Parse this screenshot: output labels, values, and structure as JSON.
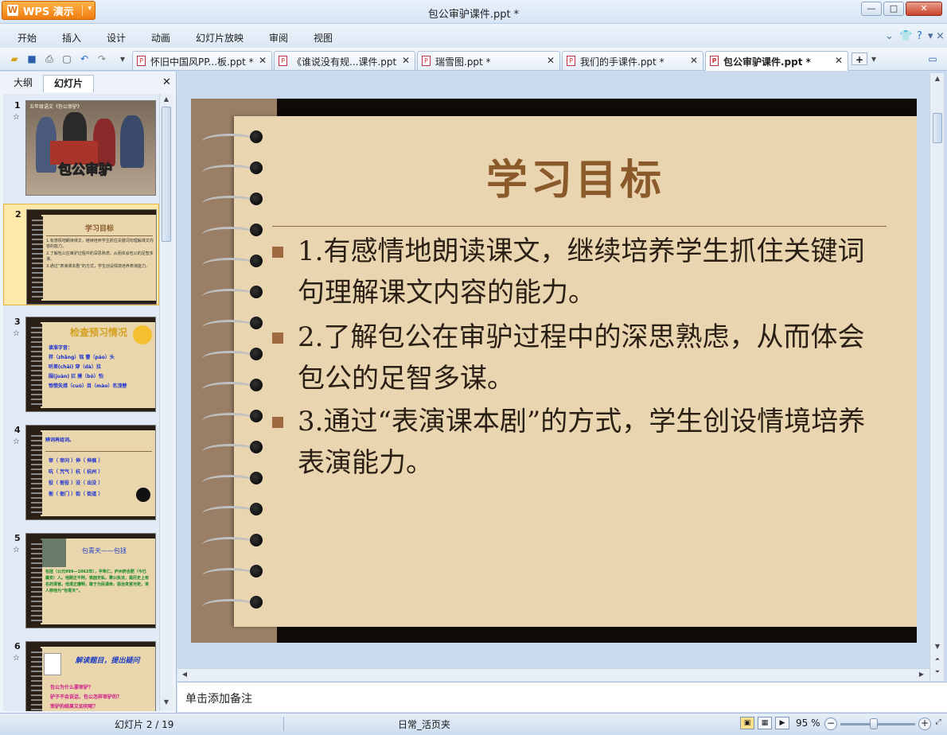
{
  "app": {
    "name": "WPS 演示",
    "logo": "W"
  },
  "window": {
    "title": "包公审驴课件.ppt *",
    "minimize": "—",
    "maximize": "□",
    "close": "✕"
  },
  "menu": {
    "items": [
      "开始",
      "插入",
      "设计",
      "动画",
      "幻灯片放映",
      "审阅",
      "视图"
    ]
  },
  "doc_tabs": [
    {
      "label": "怀旧中国风PP...板.ppt *",
      "active": false
    },
    {
      "label": "《谁说没有规...课件.ppt",
      "active": false
    },
    {
      "label": "瑞雪图.ppt *",
      "active": false
    },
    {
      "label": "我们的手课件.ppt *",
      "active": false
    },
    {
      "label": "包公审驴课件.ppt *",
      "active": true
    }
  ],
  "new_tab": "+",
  "left_panel": {
    "tabs": [
      "大纲",
      "幻灯片"
    ],
    "active_tab": "幻灯片",
    "close": "✕",
    "slides": [
      {
        "num": "1",
        "star": "☆",
        "top_text": "五年级语文《包公审驴》",
        "big_text": "包公审驴"
      },
      {
        "num": "2",
        "star": "☆",
        "title": "学习目标",
        "lines": [
          "1.有感情地朗读课文，继续培养学生抓住关键词句理解课文内容的能力。",
          "2.了解包公在审驴过程中的深思熟虑，从而体会包公的足智多谋。",
          "3.通过“表演课本剧”的方式，学生创设情境培养表演能力。"
        ]
      },
      {
        "num": "3",
        "star": "☆",
        "title": "检查预习情况",
        "lines": [
          "读准字音：",
          "拌（zhǎng）铭 曹（páo）头",
          "听差(chāi) 穿（dà）拉",
          "围(juàn) 拦 摸（bǒ）怕",
          "惊慌失措（cuò）目（mào）名顶替"
        ]
      },
      {
        "num": "4",
        "star": "☆",
        "title": "辨词再组词。",
        "lines": [
          "审（ 审问 ）伸（ 伸展 ）",
          "吭（ 咒气 ）杭（ 杭州 ）",
          "役（ 衙役 ）没（ 出没 ）",
          "衙（ 衙门 ）街（ 街道 ）"
        ]
      },
      {
        "num": "5",
        "star": "☆",
        "title": "包青天——包拯",
        "body": "包拯（公元999—1062年），字希仁，庐州府合肥（今已属安）人。他刚正不阿，铁面无私，秉公执法，是历史上有名的清官。他清正廉明，敢于为民请命，惩治贪官污吏，世人称他为“包青天”。"
      },
      {
        "num": "6",
        "star": "☆",
        "title": "解读题目，提出疑问",
        "lines": [
          "包公为什么要审驴？",
          "驴子不会说话，包公怎样审驴的？",
          "审驴的结果又如何呢？"
        ]
      }
    ]
  },
  "slide": {
    "title": "学习目标",
    "bullets": [
      "1.有感情地朗读课文，继续培养学生抓住关键词句理解课文内容的能力。",
      "2.了解包公在审驴过程中的深思熟虑，从而体会包公的足智多谋。",
      "3.通过“表演课本剧”的方式，学生创设情境培养表演能力。"
    ]
  },
  "notes": {
    "placeholder": "单击添加备注"
  },
  "status": {
    "slide_counter": "幻灯片 2 / 19",
    "theme": "日常_活页夹",
    "zoom": "95 %",
    "zoom_value": 0.95
  },
  "colors": {
    "accent": "#f07c10",
    "slide_title": "#8b5a2b",
    "paper": "#e9d5b0",
    "bullet": "#a06a40"
  }
}
